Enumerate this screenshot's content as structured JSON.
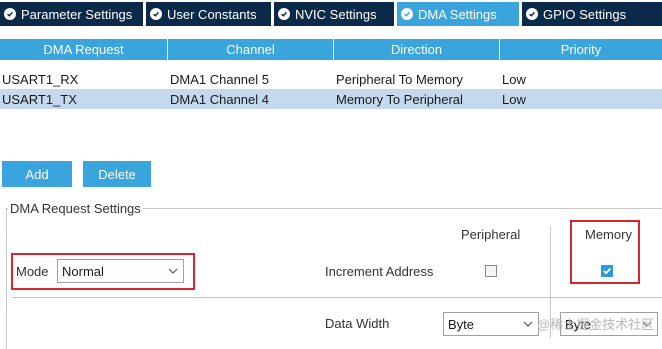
{
  "tabs": [
    {
      "label": "Parameter Settings",
      "active": false
    },
    {
      "label": "User Constants",
      "active": false
    },
    {
      "label": "NVIC Settings",
      "active": false
    },
    {
      "label": "DMA Settings",
      "active": true
    },
    {
      "label": "GPIO Settings",
      "active": false
    }
  ],
  "table": {
    "headers": [
      "DMA Request",
      "Channel",
      "Direction",
      "Priority"
    ],
    "rows": [
      {
        "request": "USART1_RX",
        "channel": "DMA1 Channel 5",
        "direction": "Peripheral To Memory",
        "priority": "Low",
        "selected": false
      },
      {
        "request": "USART1_TX",
        "channel": "DMA1 Channel 4",
        "direction": "Memory To Peripheral",
        "priority": "Low",
        "selected": true
      }
    ]
  },
  "buttons": {
    "add": "Add",
    "delete": "Delete"
  },
  "settings": {
    "legend": "DMA Request Settings",
    "mode_label": "Mode",
    "mode_value": "Normal",
    "col_peripheral": "Peripheral",
    "col_memory": "Memory",
    "increment_label": "Increment Address",
    "increment_peripheral": false,
    "increment_memory": true,
    "data_width_label": "Data Width",
    "data_width_peripheral": "Byte",
    "data_width_memory": "Byte"
  },
  "watermark": "@稀土掘金技术社区",
  "colors": {
    "tab_dark": "#0b2a4a",
    "accent": "#3aa4dc",
    "selected_row": "#c5d9ee",
    "highlight": "#d9262c"
  }
}
